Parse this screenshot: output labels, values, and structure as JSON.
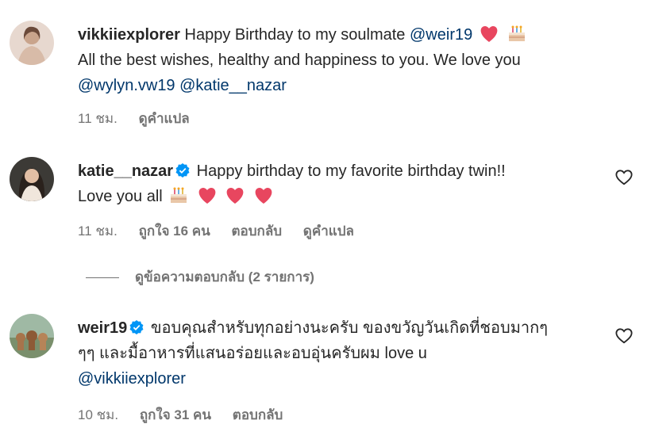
{
  "comments": [
    {
      "username": "vikkiiexplorer",
      "text_parts": [
        "Happy Birthday to my soulmate",
        "All the best wishes, healthy and happiness to you. We love you"
      ],
      "mentions": [
        "@weir19",
        "@wylyn.vw19",
        "@katie__nazar"
      ],
      "time": "11 ชม.",
      "translate": "ดูคำแปล"
    },
    {
      "username": "katie__nazar",
      "text_parts": [
        "Happy birthday to my favorite birthday twin!!",
        "Love you all"
      ],
      "time": "11 ชม.",
      "likes": "ถูกใจ 16 คน",
      "reply": "ตอบกลับ",
      "translate": "ดูคำแปล"
    },
    {
      "username": "weir19",
      "text_parts": [
        "ขอบคุณสำหรับทุกอย่างนะครับ ของขวัญวันเกิดที่ชอบมากๆ",
        "ๆๆ และมื้อาหารที่แสนอร่อยและอบอุ่นครับผม love u"
      ],
      "mentions": [
        "@vikkiiexplorer"
      ],
      "time": "10 ชม.",
      "likes": "ถูกใจ 31 คน",
      "reply": "ตอบกลับ"
    }
  ],
  "view_replies": "ดูข้อความตอบกลับ (2 รายการ)",
  "colors": {
    "mention": "#00376b",
    "verified": "#0095f6",
    "heart": "#ed4956",
    "meta": "#737373"
  },
  "icons": [
    "heart-emoji",
    "cake-emoji",
    "verified-badge-icon",
    "like-heart-icon"
  ]
}
